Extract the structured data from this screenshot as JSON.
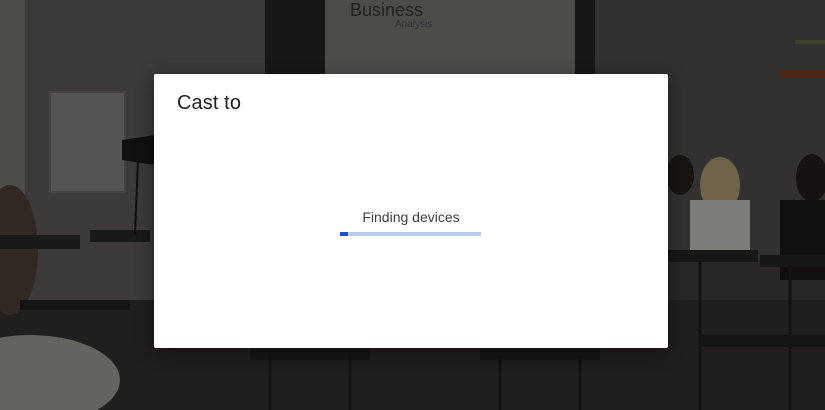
{
  "background": {
    "slide_title": "Business",
    "slide_subtitle": "Analysis"
  },
  "dialog": {
    "title": "Cast to",
    "status_text": "Finding devices",
    "progress_fraction": 0.06,
    "accent_color": "#1a56b8",
    "track_color": "#b8cdea"
  }
}
